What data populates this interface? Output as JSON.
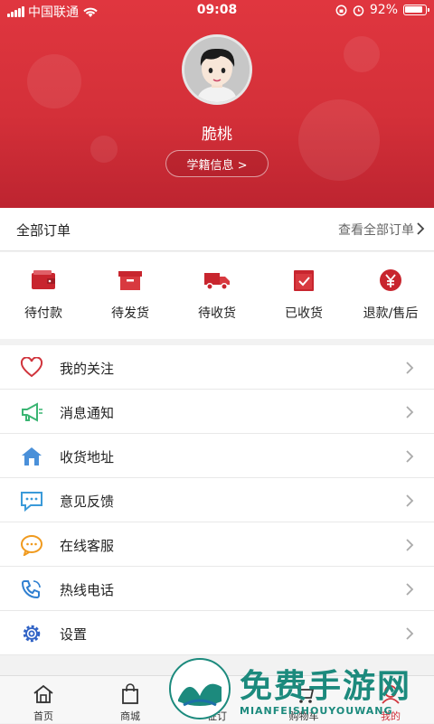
{
  "status_bar": {
    "carrier": "中国联通",
    "time": "09:08",
    "battery": "92%"
  },
  "profile": {
    "name": "脆桃",
    "school_button": "学籍信息 >"
  },
  "orders": {
    "title": "全部订单",
    "view_all": "查看全部订单",
    "items": [
      {
        "label": "待付款",
        "icon": "wallet-icon"
      },
      {
        "label": "待发货",
        "icon": "box-icon"
      },
      {
        "label": "待收货",
        "icon": "truck-icon"
      },
      {
        "label": "已收货",
        "icon": "received-box-icon"
      },
      {
        "label": "退款/售后",
        "icon": "yen-refund-icon"
      }
    ]
  },
  "menu": [
    {
      "label": "我的关注",
      "icon": "heart-icon"
    },
    {
      "label": "消息通知",
      "icon": "megaphone-icon"
    },
    {
      "label": "收货地址",
      "icon": "house-icon"
    },
    {
      "label": "意见反馈",
      "icon": "chat-bubble-icon"
    },
    {
      "label": "在线客服",
      "icon": "customer-service-icon"
    },
    {
      "label": "热线电话",
      "icon": "phone-icon"
    },
    {
      "label": "设置",
      "icon": "gear-icon"
    }
  ],
  "tabbar": [
    {
      "label": "首页",
      "icon": "home-icon"
    },
    {
      "label": "商城",
      "icon": "shopping-bag-icon"
    },
    {
      "label": "征订",
      "icon": "subscribe-icon"
    },
    {
      "label": "购物车",
      "icon": "cart-icon"
    },
    {
      "label": "我的",
      "icon": "user-icon"
    }
  ],
  "watermark": {
    "title": "免费手游网",
    "subtitle": "MIANFEISHOUYOUWANG"
  },
  "colors": {
    "brand_red": "#d43039",
    "menu_accent_red": "#c8252e",
    "watermark_green": "#1c8a7d"
  }
}
